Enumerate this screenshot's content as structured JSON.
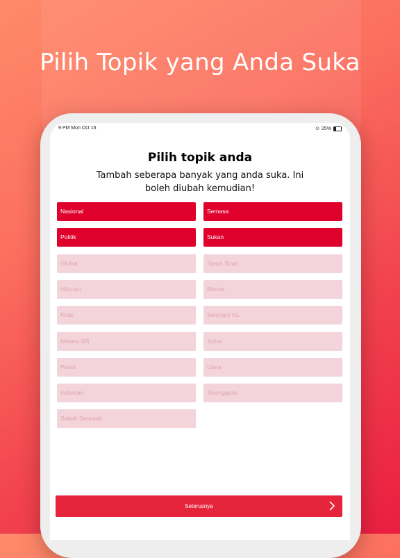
{
  "headline": "Pilih Topik yang Anda Suka",
  "status": {
    "time": "9 PM",
    "date": "Mon Oct 16",
    "battery": "25%"
  },
  "title": "Pilih topik anda",
  "subtitle": "Tambah seberapa banyak yang anda suka. Ini boleh diubah kemudian!",
  "topics": [
    {
      "label": "Nasional",
      "selected": true
    },
    {
      "label": "Semasa",
      "selected": true
    },
    {
      "label": "Politik",
      "selected": true
    },
    {
      "label": "Sukan",
      "selected": true
    },
    {
      "label": "Global",
      "selected": false
    },
    {
      "label": "Suara Sinar",
      "selected": false
    },
    {
      "label": "Hiburan",
      "selected": false
    },
    {
      "label": "Bisnes",
      "selected": false
    },
    {
      "label": "Khas",
      "selected": false
    },
    {
      "label": "Selangor KL",
      "selected": false
    },
    {
      "label": "Melaka NS",
      "selected": false
    },
    {
      "label": "Johor",
      "selected": false
    },
    {
      "label": "Perak",
      "selected": false
    },
    {
      "label": "Utara",
      "selected": false
    },
    {
      "label": "Kelantan",
      "selected": false
    },
    {
      "label": "Terengganu",
      "selected": false
    },
    {
      "label": "Sabah Sarawak",
      "selected": false
    }
  ],
  "next_button": {
    "label": "Seterusnya",
    "icon": "chevron-right-icon"
  },
  "colors": {
    "selected": "#e0002c",
    "unselected": "#f2d4da",
    "button": "#e5243b"
  }
}
